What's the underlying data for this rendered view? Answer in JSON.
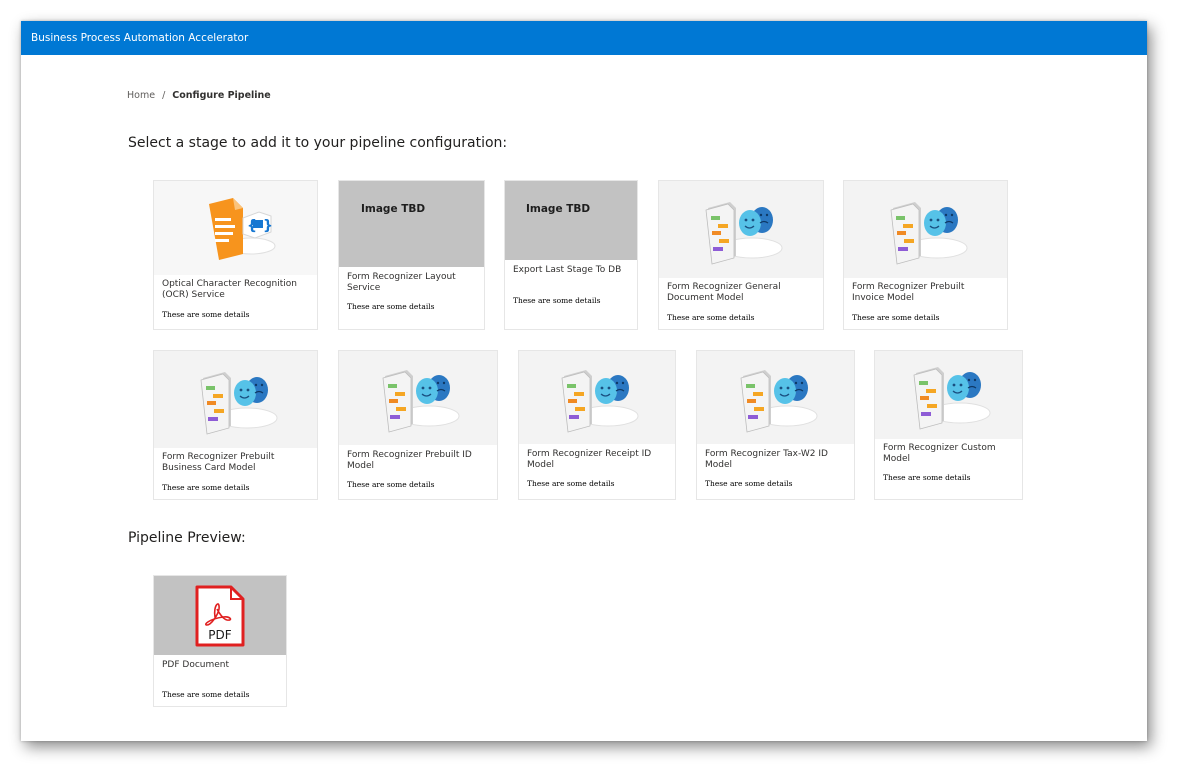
{
  "app": {
    "title": "Business Process Automation Accelerator"
  },
  "breadcrumb": {
    "home": "Home",
    "separator": "/",
    "current": "Configure Pipeline"
  },
  "stages_heading": "Select a stage to add it to your pipeline configuration:",
  "preview_heading": "Pipeline Preview:",
  "image_tbd_label": "Image TBD",
  "stages": [
    {
      "title": "Optical Character Recognition (OCR) Service",
      "details": "These are some details",
      "image": "ocr-icon"
    },
    {
      "title": "Form Recognizer Layout Service",
      "details": "These are some details",
      "image": "image-tbd"
    },
    {
      "title": "Export Last Stage To DB",
      "details": "These are some details",
      "image": "image-tbd"
    },
    {
      "title": "Form Recognizer General Document Model",
      "details": "These are some details",
      "image": "form-recognizer-icon"
    },
    {
      "title": "Form Recognizer Prebuilt Invoice Model",
      "details": "These are some details",
      "image": "form-recognizer-icon"
    },
    {
      "title": "Form Recognizer Prebuilt Business Card Model",
      "details": "These are some details",
      "image": "form-recognizer-icon"
    },
    {
      "title": "Form Recognizer Prebuilt ID Model",
      "details": "These are some details",
      "image": "form-recognizer-icon"
    },
    {
      "title": "Form Recognizer Receipt ID Model",
      "details": "These are some details",
      "image": "form-recognizer-icon"
    },
    {
      "title": "Form Recognizer Tax-W2 ID Model",
      "details": "These are some details",
      "image": "form-recognizer-icon"
    },
    {
      "title": "Form Recognizer Custom Model",
      "details": "These are some details",
      "image": "form-recognizer-icon"
    }
  ],
  "preview": [
    {
      "title": "PDF Document",
      "details": "These are some details",
      "image": "pdf-icon",
      "icon_text": "PDF"
    }
  ],
  "colors": {
    "header": "#0078d4",
    "placeholder": "#c2c2c2",
    "pdf_red": "#e02020",
    "ocr_orange": "#f7941d",
    "face_blue": "#3aa0e0"
  }
}
